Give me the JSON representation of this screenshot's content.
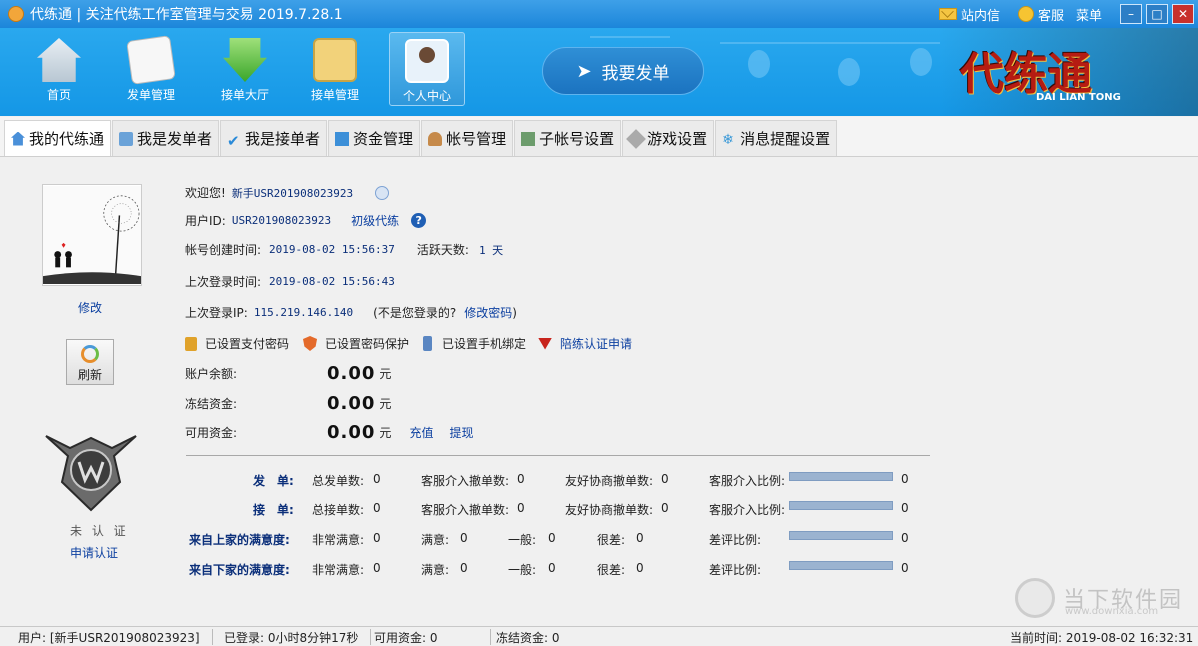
{
  "window": {
    "title": "代练通 | 关注代练工作室管理与交易 2019.7.28.1",
    "mail_label": "站内信",
    "service_label": "客服",
    "menu_label": "菜单"
  },
  "toolbar": {
    "items": [
      {
        "label": "首页",
        "icon": "home-icon"
      },
      {
        "label": "发单管理",
        "icon": "order-doc-icon"
      },
      {
        "label": "接单大厅",
        "icon": "download-arrow-icon"
      },
      {
        "label": "接单管理",
        "icon": "clipboard-icon"
      },
      {
        "label": "个人中心",
        "icon": "user-avatar-icon"
      }
    ],
    "active": "个人中心",
    "publish_label": "我要发单",
    "logo_text": "代练通",
    "logo_subtext": "DAI LIAN TONG"
  },
  "tabs": [
    {
      "label": "我的代练通",
      "icon": "home-icon"
    },
    {
      "label": "我是发单者",
      "icon": "edit-icon"
    },
    {
      "label": "我是接单者",
      "icon": "check-icon"
    },
    {
      "label": "资金管理",
      "icon": "money-icon"
    },
    {
      "label": "帐号管理",
      "icon": "person-icon"
    },
    {
      "label": "子帐号设置",
      "icon": "sub-account-icon"
    },
    {
      "label": "游戏设置",
      "icon": "wrench-icon"
    },
    {
      "label": "消息提醒设置",
      "icon": "snowflake-icon"
    }
  ],
  "profile": {
    "modify_link": "修改",
    "refresh_label": "刷新",
    "cert_status": "未 认 证",
    "apply_cert_link": "申请认证"
  },
  "info": {
    "welcome_label": "欢迎您!",
    "username": "新手USR201908023923",
    "user_id_label": "用户ID:",
    "user_id": "USR201908023923",
    "level": "初级代练",
    "created_label": "帐号创建时间:",
    "created_time": "2019-08-02 15:56:37",
    "active_days_label": "活跃天数:",
    "active_days": "1 天",
    "last_login_label": "上次登录时间:",
    "last_login_time": "2019-08-02 15:56:43",
    "last_ip_label": "上次登录IP:",
    "last_ip": "115.219.146.140",
    "not_you_text": "(不是您登录的?",
    "change_pwd_link": "修改密码",
    "not_you_close": ")",
    "security": [
      {
        "label": "已设置支付密码",
        "icon": "lock-icon"
      },
      {
        "label": "已设置密码保护",
        "icon": "shield-icon"
      },
      {
        "label": "已设置手机绑定",
        "icon": "phone-icon"
      },
      {
        "label": "陪练认证申请",
        "icon": "v-badge-icon"
      }
    ],
    "balance_label": "账户余额:",
    "balance": "0.00",
    "frozen_label": "冻结资金:",
    "frozen": "0.00",
    "available_label": "可用资金:",
    "available": "0.00",
    "currency": "元",
    "recharge_link": "充值",
    "withdraw_link": "提现"
  },
  "stats": [
    {
      "label": "发　单:",
      "c1": "总发单数:",
      "v1": "0",
      "c2": "客服介入撤单数:",
      "v2": "0",
      "c3": "友好协商撤单数:",
      "v3": "0",
      "c4": "客服介入比例:",
      "v4": "0"
    },
    {
      "label": "接　单:",
      "c1": "总接单数:",
      "v1": "0",
      "c2": "客服介入撤单数:",
      "v2": "0",
      "c3": "友好协商撤单数:",
      "v3": "0",
      "c4": "客服介入比例:",
      "v4": "0"
    },
    {
      "label": "来自上家的满意度:",
      "c1": "非常满意:",
      "v1": "0",
      "c2": "满意:",
      "v2": "0",
      "c2b": "一般:",
      "v2b": "0",
      "c3": "很差:",
      "v3": "0",
      "c4": "差评比例:",
      "v4": "0"
    },
    {
      "label": "来自下家的满意度:",
      "c1": "非常满意:",
      "v1": "0",
      "c2": "满意:",
      "v2": "0",
      "c2b": "一般:",
      "v2b": "0",
      "c3": "很差:",
      "v3": "0",
      "c4": "差评比例:",
      "v4": "0"
    }
  ],
  "statusbar": {
    "user": "用户: [新手USR201908023923]",
    "logged_in": "已登录: 0小时8分钟17秒",
    "available": "可用资金: 0",
    "frozen": "冻结资金: 0",
    "current_time": "当前时间: 2019-08-02 16:32:31"
  },
  "watermark": {
    "text": "当下软件园",
    "url": "www.downxia.com"
  }
}
